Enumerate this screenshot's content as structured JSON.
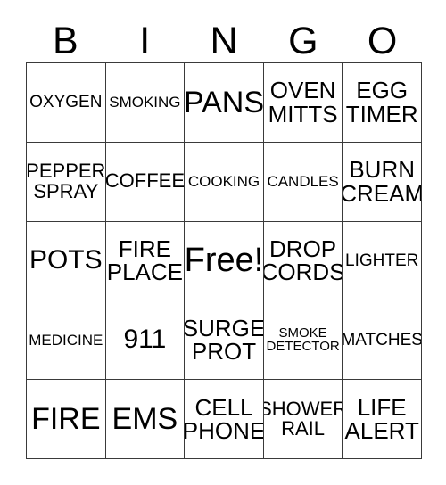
{
  "card": {
    "title_letters": [
      "B",
      "I",
      "N",
      "G",
      "O"
    ],
    "colors": {
      "background": "#ffffff",
      "text": "#000000",
      "grid_line": "#3a3a3a"
    },
    "grid": {
      "columns": 5,
      "rows": 5,
      "free_space_label": "Free!",
      "free_space_position": {
        "row": 3,
        "column": 3
      }
    },
    "cells": [
      [
        {
          "label": "OXYGEN",
          "lines": [
            "OXYGEN"
          ],
          "size": "md"
        },
        {
          "label": "SMOKING",
          "lines": [
            "SMOKING"
          ],
          "size": "sm"
        },
        {
          "label": "PANS",
          "lines": [
            "PANS"
          ],
          "size": "3xl"
        },
        {
          "label": "OVEN MITTS",
          "lines": [
            "OVEN",
            "MITTS"
          ],
          "size": "xl"
        },
        {
          "label": "EGG TIMER",
          "lines": [
            "EGG",
            "TIMER"
          ],
          "size": "xl"
        }
      ],
      [
        {
          "label": "PEPPER SPRAY",
          "lines": [
            "PEPPER",
            "SPRAY"
          ],
          "size": "lg"
        },
        {
          "label": "COFFEE",
          "lines": [
            "COFFEE"
          ],
          "size": "lg"
        },
        {
          "label": "COOKING",
          "lines": [
            "COOKING"
          ],
          "size": "sm"
        },
        {
          "label": "CANDLES",
          "lines": [
            "CANDLES"
          ],
          "size": "sm"
        },
        {
          "label": "BURN CREAM",
          "lines": [
            "BURN",
            "CREAM"
          ],
          "size": "xl"
        }
      ],
      [
        {
          "label": "POTS",
          "lines": [
            "POTS"
          ],
          "size": "2xl"
        },
        {
          "label": "FIRE PLACE",
          "lines": [
            "FIRE",
            "PLACE"
          ],
          "size": "xl"
        },
        {
          "label": "Free!",
          "lines": [
            "Free!"
          ],
          "size": "4xl"
        },
        {
          "label": "DROP CORDS",
          "lines": [
            "DROP",
            "CORDS"
          ],
          "size": "xl"
        },
        {
          "label": "LIGHTER",
          "lines": [
            "LIGHTER"
          ],
          "size": "md"
        }
      ],
      [
        {
          "label": "MEDICINE",
          "lines": [
            "MEDICINE"
          ],
          "size": "sm"
        },
        {
          "label": "911",
          "lines": [
            "911"
          ],
          "size": "2xl"
        },
        {
          "label": "SURGE PROT",
          "lines": [
            "SURGE",
            "PROT"
          ],
          "size": "xl"
        },
        {
          "label": "SMOKE DETECTOR",
          "lines": [
            "SMOKE",
            "DETECTOR"
          ],
          "size": "xs"
        },
        {
          "label": "MATCHES",
          "lines": [
            "MATCHES"
          ],
          "size": "md"
        }
      ],
      [
        {
          "label": "FIRE",
          "lines": [
            "FIRE"
          ],
          "size": "3xl"
        },
        {
          "label": "EMS",
          "lines": [
            "EMS"
          ],
          "size": "3xl"
        },
        {
          "label": "CELL PHONE",
          "lines": [
            "CELL",
            "PHONE"
          ],
          "size": "xl"
        },
        {
          "label": "SHOWER RAIL",
          "lines": [
            "SHOWER",
            "RAIL"
          ],
          "size": "lg"
        },
        {
          "label": "LIFE ALERT",
          "lines": [
            "LIFE",
            "ALERT"
          ],
          "size": "xl"
        }
      ]
    ]
  }
}
